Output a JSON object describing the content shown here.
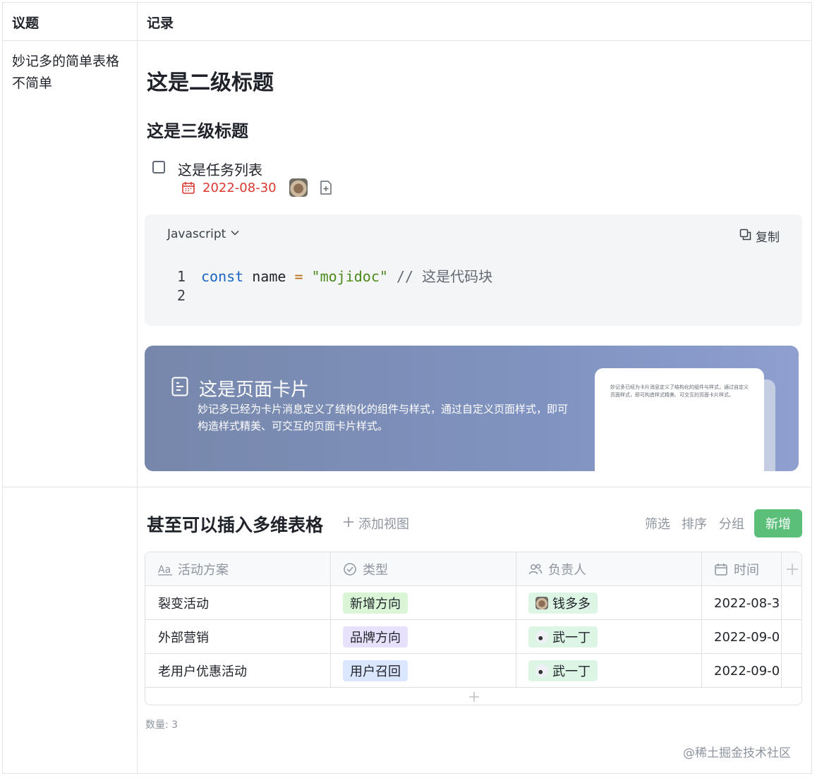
{
  "table": {
    "header_topic": "议题",
    "header_record": "记录",
    "row1_topic": "妙记多的简单表格不简单"
  },
  "doc": {
    "h2": "这是二级标题",
    "h3": "这是三级标题",
    "task": {
      "text": "这是任务列表",
      "date": "2022-08-30"
    },
    "code": {
      "language": "Javascript",
      "copy_label": "复制",
      "lines": [
        {
          "num": "1",
          "kw": "const",
          "id": " name ",
          "op": "=",
          "str": " \"mojidoc\"",
          "cm": " // 这是代码块"
        },
        {
          "num": "2"
        }
      ]
    },
    "card": {
      "title": "这是页面卡片",
      "desc": "妙记多已经为卡片消息定义了结构化的组件与样式，通过自定义页面样式，即可构造样式精美、可交互的页面卡片样式。",
      "preview_text": "妙记多已经为卡片消息定义了结构化的组件与样式，通过自定义页面样式，即可构造样式精美、可交互的页面卡片样式。"
    }
  },
  "bitable": {
    "title": "甚至可以插入多维表格",
    "add_view": "添加视图",
    "filter": "筛选",
    "sort": "排序",
    "group": "分组",
    "new": "新增",
    "columns": [
      "活动方案",
      "类型",
      "负责人",
      "时间"
    ],
    "rows": [
      {
        "plan": "裂变活动",
        "type": "新增方向",
        "owner": "钱多多",
        "time": "2022-08-3"
      },
      {
        "plan": "外部营销",
        "type": "品牌方向",
        "owner": "武一丁",
        "time": "2022-09-0"
      },
      {
        "plan": "老用户优惠活动",
        "type": "用户召回",
        "owner": "武一丁",
        "time": "2022-09-0"
      }
    ],
    "count_label": "数量: 3"
  },
  "watermark": "@稀土掘金技术社区",
  "colors": {
    "date_red": "#d83931",
    "new_button": "#5bbf7a",
    "card_gradient_start": "#7787ab",
    "card_gradient_end": "#8e9fd0"
  },
  "icons": [
    "checkbox-icon",
    "calendar-icon",
    "add-doc-icon",
    "chevron-down-icon",
    "copy-icon",
    "page-card-icon",
    "plus-icon",
    "text-field-icon",
    "single-select-icon",
    "person-field-icon",
    "date-field-icon"
  ]
}
